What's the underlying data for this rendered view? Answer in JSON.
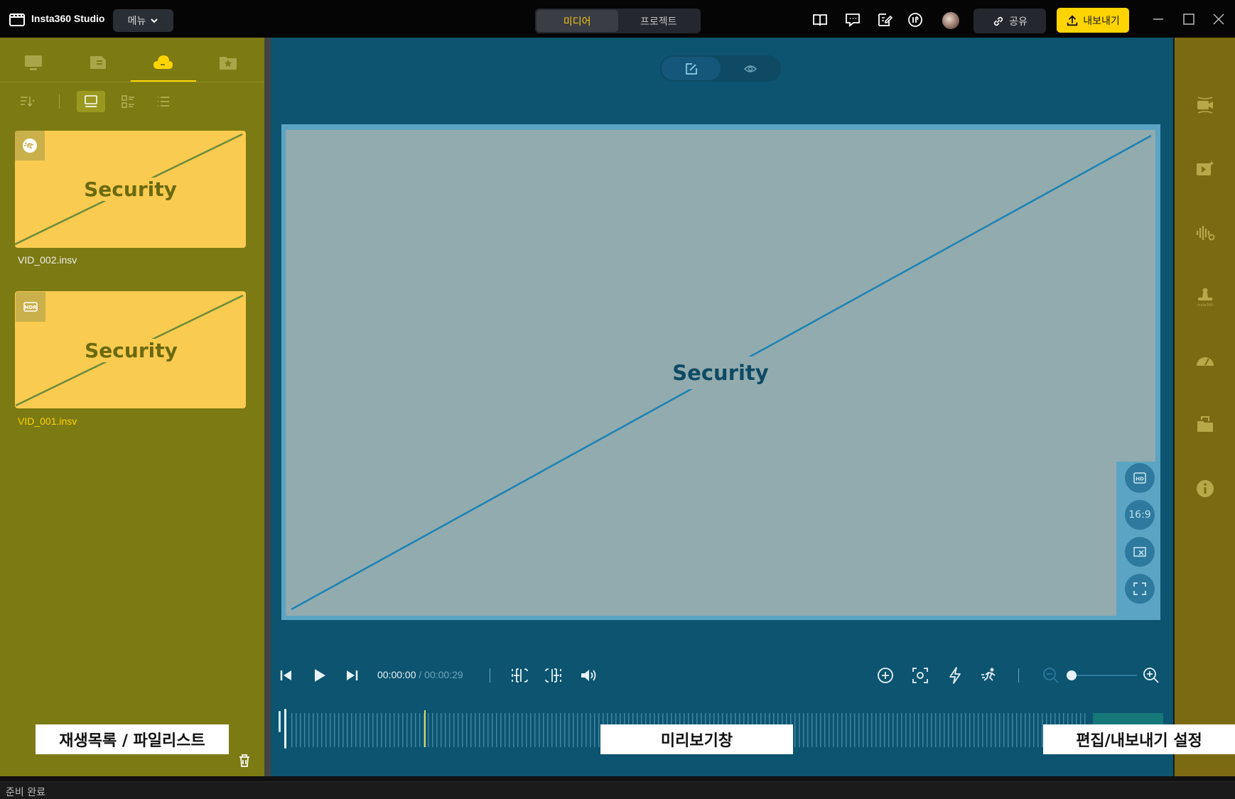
{
  "app": {
    "title": "Insta360 Studio",
    "menu_label": "메뉴",
    "share_label": "공유",
    "export_label": "내보내기"
  },
  "mode_tabs": [
    {
      "label": "미디어",
      "active": true
    },
    {
      "label": "프로젝트",
      "active": false
    }
  ],
  "media_items": [
    {
      "thumbnail_text": "Security",
      "file_name": "VID_002.insv",
      "badge_icon": "speed-runner-icon",
      "selected": false
    },
    {
      "thumbnail_text": "Security",
      "file_name": "VID_001.insv",
      "badge_icon": "hdr-icon",
      "selected": true
    }
  ],
  "preview": {
    "placeholder_text": "Security",
    "side_tools": [
      "hd-icon",
      "16:9",
      "clear-crop-icon",
      "fullscreen-icon"
    ]
  },
  "playback": {
    "current_time": "00:00:00",
    "total_time": "/ 00:00:29",
    "zoom_level": 0.0
  },
  "annotations": {
    "left": "재생목록 / 파일리스트",
    "center": "미리보기창",
    "right": "편집/내보내기 설정"
  },
  "status": {
    "text": "준비 완료"
  },
  "colors": {
    "accent": "#ffd400",
    "left_panel": "#7c7a12",
    "center_panel": "#0c5470",
    "right_panel": "#7c6a12",
    "thumbnail": "#f9cb50",
    "preview": "#92abae"
  }
}
